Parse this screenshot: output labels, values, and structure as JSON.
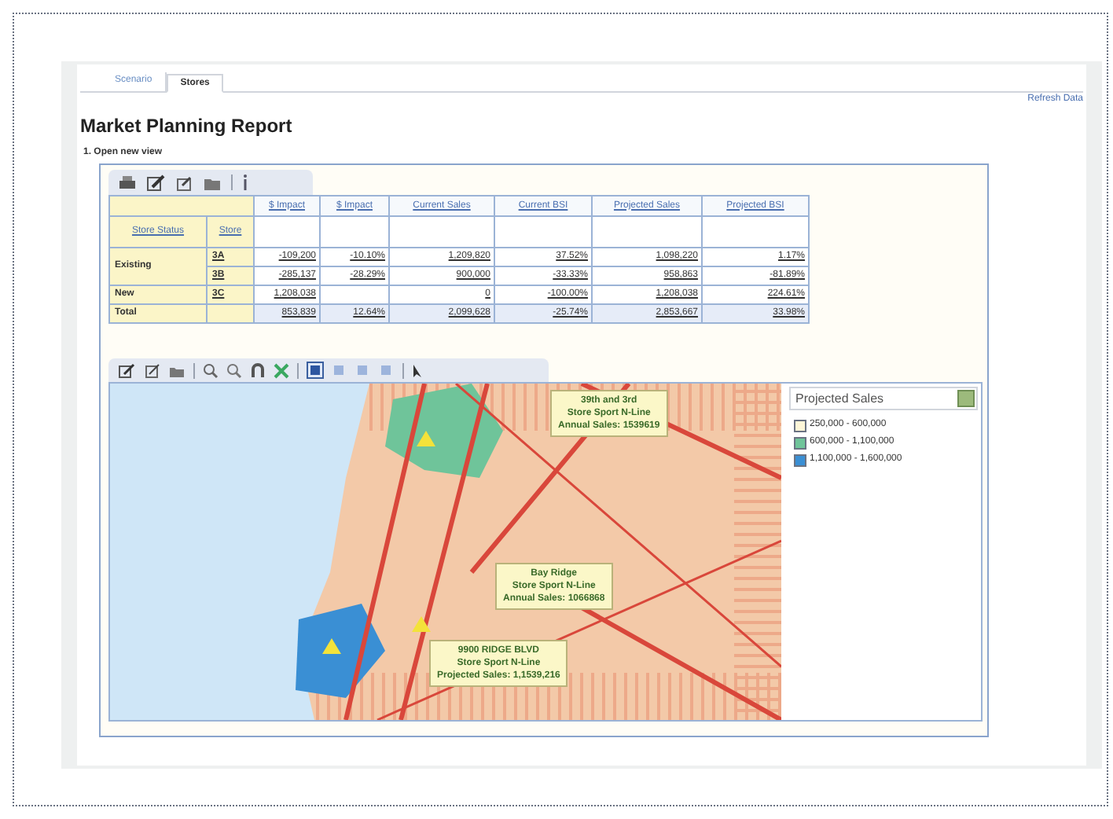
{
  "tabs": [
    {
      "label": "Scenario",
      "selected": false
    },
    {
      "label": "Stores",
      "selected": true
    }
  ],
  "refresh_link": "Refresh Data",
  "title": "Market Planning Report",
  "section_label": "1. Open new view",
  "table": {
    "corner_columns": [
      "Store Status",
      "Store"
    ],
    "columns": [
      "$ Impact",
      "$ Impact",
      "Current Sales",
      "Current BSI",
      "Projected Sales",
      "Projected BSI"
    ],
    "groups": [
      {
        "status": "Existing",
        "rows": [
          {
            "store": "3A",
            "cells": [
              "-109,200",
              "-10.10%",
              "1,209,820",
              "37.52%",
              "1,098,220",
              "1.17%"
            ]
          },
          {
            "store": "3B",
            "cells": [
              "-285,137",
              "-28.29%",
              "900,000",
              "-33.33%",
              "958,863",
              "-81.89%"
            ]
          }
        ]
      },
      {
        "status": "New",
        "rows": [
          {
            "store": "3C",
            "cells": [
              "1,208,038",
              "",
              "0",
              "-100.00%",
              "1,208,038",
              "224.61%"
            ]
          }
        ]
      }
    ],
    "total": {
      "label": "Total",
      "cells": [
        "853,839",
        "12.64%",
        "2,099,628",
        "-25.74%",
        "2,853,667",
        "33.98%"
      ]
    }
  },
  "map_toolbar": {
    "layout_buttons": [
      {
        "selected": true
      },
      {
        "selected": false
      },
      {
        "selected": false
      },
      {
        "selected": false
      }
    ]
  },
  "map": {
    "kind": "picture",
    "callouts": [
      {
        "lines": [
          "39th and 3rd",
          "Store Sport N-Line",
          "Annual Sales: 1539619"
        ]
      },
      {
        "lines": [
          "Bay Ridge",
          "Store Sport N-Line",
          "Annual Sales: 1066868"
        ]
      },
      {
        "lines": [
          "9900 RIDGE BLVD",
          "Store Sport N-Line",
          "Projected Sales: 1,1539,216"
        ]
      }
    ]
  },
  "legend": {
    "title": "Projected Sales",
    "items": [
      {
        "label": "250,000 - 600,000",
        "color": "#fdf6d8"
      },
      {
        "label": "600,000 - 1,100,000",
        "color": "#6fc49a"
      },
      {
        "label": "1,100,000 - 1,600,000",
        "color": "#3a8fd4"
      }
    ]
  }
}
